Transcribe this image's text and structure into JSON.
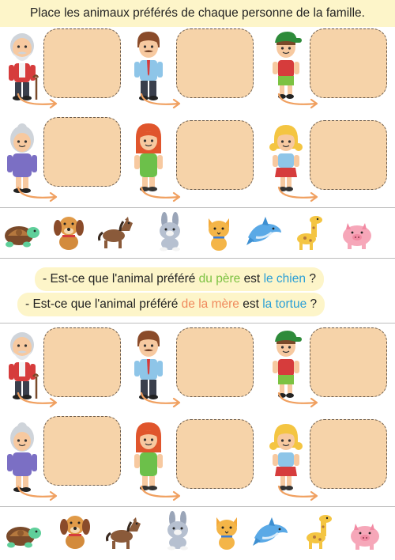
{
  "title": "Place les animaux préférés de chaque personne de la famille.",
  "people": [
    "grandfather",
    "father",
    "boy",
    "grandmother",
    "mother",
    "girl"
  ],
  "animals": [
    "turtle",
    "dog",
    "horse",
    "rabbit",
    "cat",
    "dolphin",
    "giraffe",
    "pig"
  ],
  "question1": {
    "prefix": "- Est-ce que l'animal préféré ",
    "subject": "du père",
    "mid": " est ",
    "animal": "le chien",
    "suffix": " ?"
  },
  "question2": {
    "prefix": "- Est-ce que l'animal préféré ",
    "subject": "de la mère",
    "mid": " est ",
    "animal": "la tortue",
    "suffix": " ?"
  },
  "colors": {
    "box_fill": "#f6d3a9",
    "arrow": "#f0a060",
    "highlight": "#fdf5c9",
    "text_green": "#7cc242",
    "text_blue": "#2a9fd6",
    "text_orange": "#f08a5d"
  }
}
